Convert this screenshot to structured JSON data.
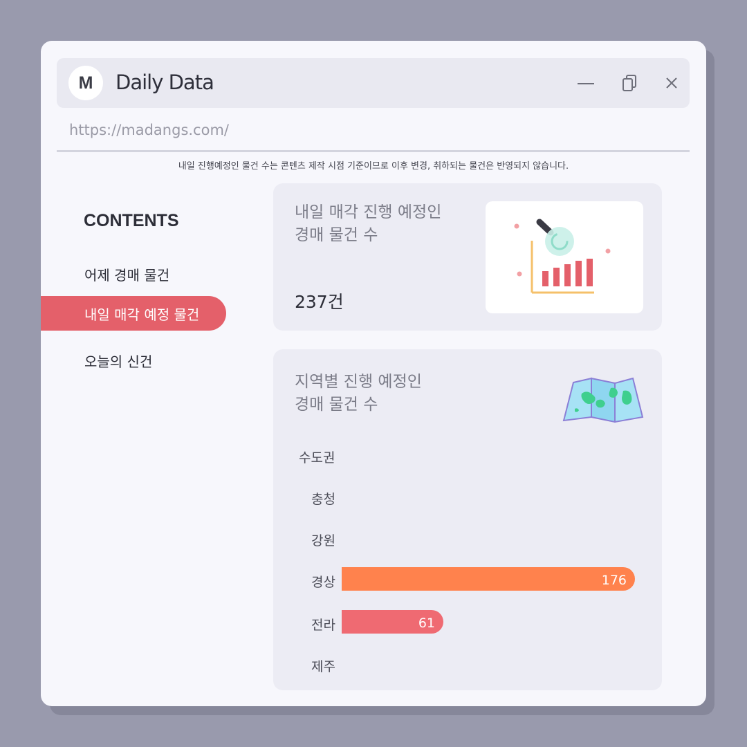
{
  "window": {
    "avatar_letter": "M",
    "title": "Daily Data",
    "url": "https://madangs.com/"
  },
  "notice": "내일 진행예정인 물건 수는 콘텐츠 제작 시점 기준이므로 이후 변경, 취하되는 물건은 반영되지 않습니다.",
  "sidebar": {
    "title": "CONTENTS",
    "items": [
      {
        "label": "어제 경매 물건",
        "active": false
      },
      {
        "label": "내일 매각 예정 물건",
        "active": true
      },
      {
        "label": "오늘의 신건",
        "active": false
      }
    ]
  },
  "summary_card": {
    "title_line1": "내일 매각 진행 예정인",
    "title_line2": "경매 물건 수",
    "value": "237건",
    "icon": "chart-magnifier-icon"
  },
  "region_card": {
    "title_line1": "지역별 진행 예정인",
    "title_line2": "경매 물건 수",
    "icon": "map-icon"
  },
  "colors": {
    "accent": "#e4606a",
    "bar_orange": "#ff824d",
    "bar_red": "#ef6a72"
  },
  "chart_data": {
    "type": "bar",
    "orientation": "horizontal",
    "categories": [
      "수도권",
      "충청",
      "강원",
      "경상",
      "전라",
      "제주"
    ],
    "values": [
      null,
      null,
      null,
      176,
      61,
      null
    ],
    "value_labels": [
      "",
      "",
      "",
      "176",
      "61",
      ""
    ],
    "bar_colors": [
      "",
      "",
      "",
      "#ff824d",
      "#ef6a72",
      ""
    ]
  }
}
